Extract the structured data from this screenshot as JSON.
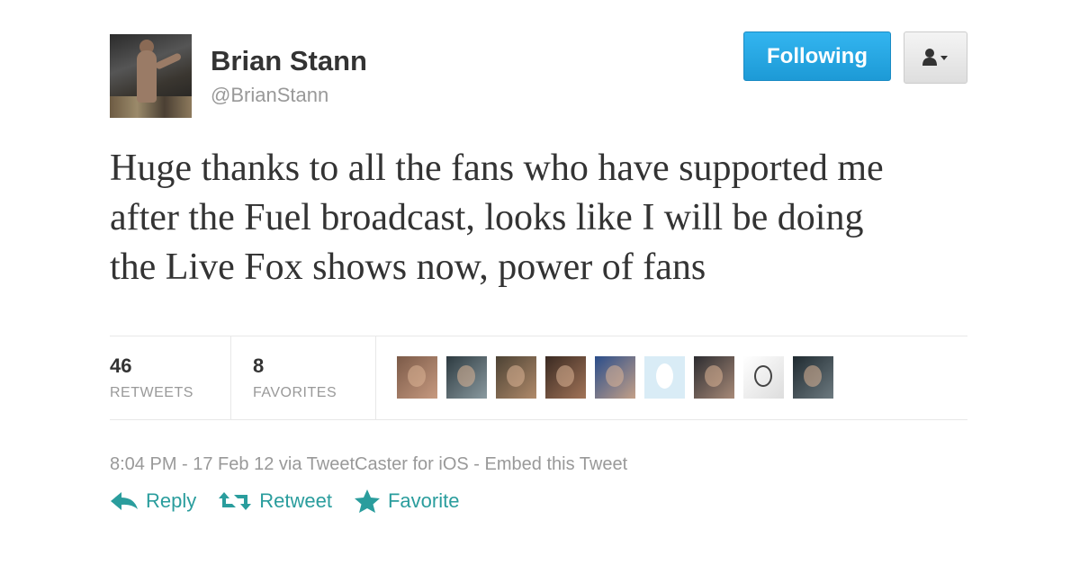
{
  "author": {
    "name": "Brian Stann",
    "handle": "@BrianStann"
  },
  "follow_button": {
    "label": "Following",
    "color": "#1d9ad6"
  },
  "user_menu": {
    "icon": "user-dropdown-icon"
  },
  "tweet": {
    "lines": [
      "Huge thanks to all the fans who have supported me",
      "after the Fuel broadcast, looks like I will be doing",
      "the Live Fox shows now, power of fans"
    ]
  },
  "stats": {
    "retweets": {
      "count": "46",
      "label": "RETWEETS"
    },
    "favorites": {
      "count": "8",
      "label": "FAVORITES"
    }
  },
  "favoriters": [
    {
      "color_a": "#7b5a48",
      "color_b": "#c79a80"
    },
    {
      "color_a": "#2d3a40",
      "color_b": "#8a9aa0"
    },
    {
      "color_a": "#4c4234",
      "color_b": "#b08a6a"
    },
    {
      "color_a": "#3a2a22",
      "color_b": "#a27458"
    },
    {
      "color_a": "#2a4d8a",
      "color_b": "#c4a088"
    },
    {
      "color_a": "#d9ecf6",
      "color_b": "#b9dcee",
      "type": "egg"
    },
    {
      "color_a": "#2c2c30",
      "color_b": "#a88a78"
    },
    {
      "color_a": "#ffffff",
      "color_b": "#dddddd",
      "type": "sketch"
    },
    {
      "color_a": "#1f2a30",
      "color_b": "#6d7a80"
    }
  ],
  "meta": {
    "time": "8:04 PM - 17 Feb 12",
    "via": "via TweetCaster for iOS",
    "embed": "Embed this Tweet"
  },
  "actions": {
    "reply": "Reply",
    "retweet": "Retweet",
    "favorite": "Favorite",
    "color": "#2a9d9d"
  }
}
